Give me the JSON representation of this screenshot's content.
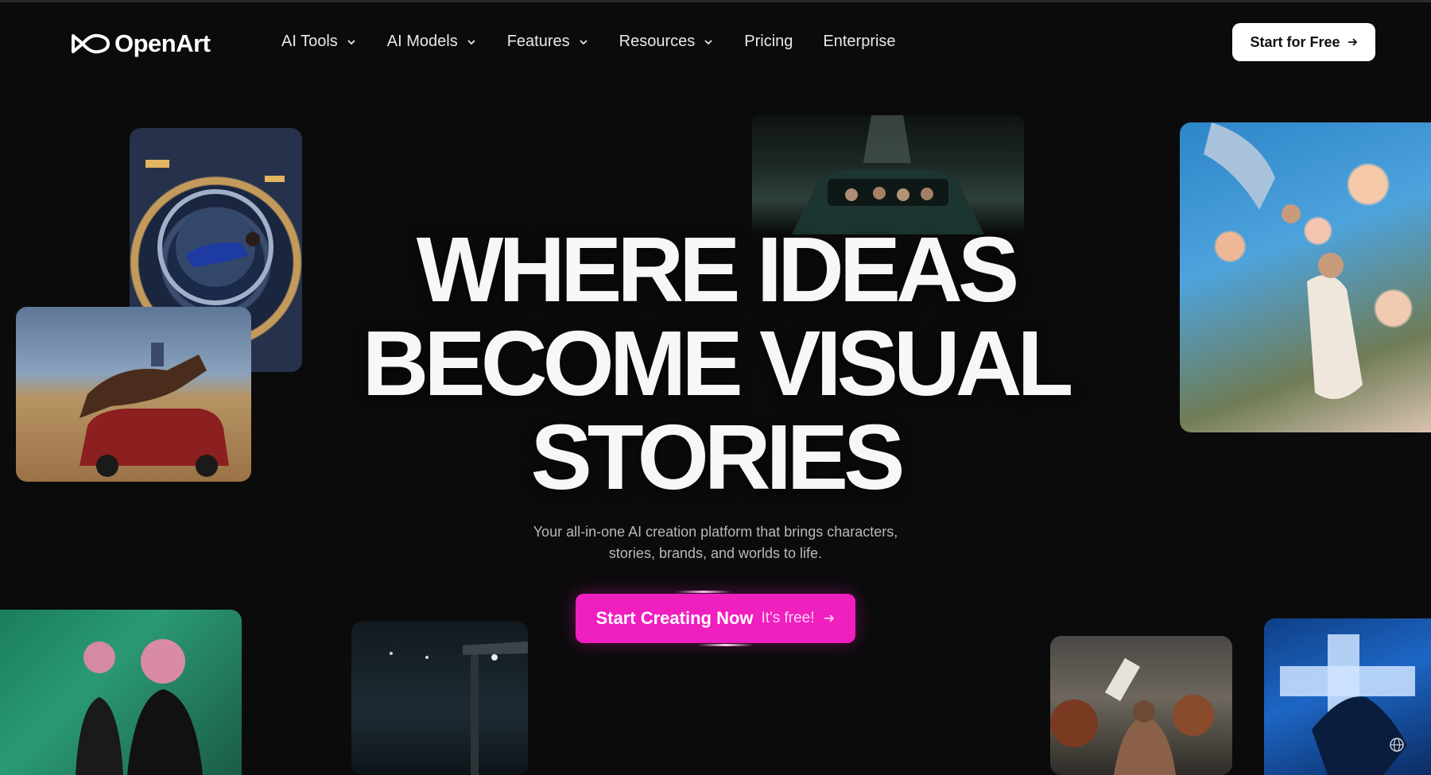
{
  "brand": {
    "name": "OpenArt"
  },
  "nav": {
    "items": [
      {
        "label": "AI Tools",
        "dropdown": true
      },
      {
        "label": "AI Models",
        "dropdown": true
      },
      {
        "label": "Features",
        "dropdown": true
      },
      {
        "label": "Resources",
        "dropdown": true
      },
      {
        "label": "Pricing",
        "dropdown": false
      },
      {
        "label": "Enterprise",
        "dropdown": false
      }
    ],
    "cta_label": "Start for Free"
  },
  "hero": {
    "title_lines": [
      "WHERE IDEAS",
      "BECOME VISUAL",
      "STORIES"
    ],
    "subtitle_line1": "Your all-in-one AI creation platform that brings characters,",
    "subtitle_line2": "stories, brands, and worlds to life.",
    "cta_primary": "Start Creating Now",
    "cta_secondary": "It's free!"
  },
  "icons": {
    "logo": "infinity-logo-icon",
    "chevron": "chevron-down-icon",
    "arrow": "arrow-right-icon",
    "globe": "globe-icon"
  },
  "colors": {
    "background": "#0b0b0c",
    "accent": "#f01fbf",
    "cta_top_bg": "#ffffff"
  }
}
